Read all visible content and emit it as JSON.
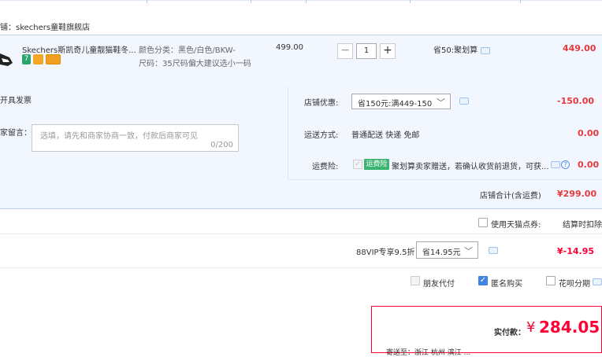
{
  "store": {
    "name": "铺：skechers童鞋旗舰店"
  },
  "item": {
    "title": "Skechers斯凯奇儿童靓猫鞋冬...",
    "sku_line1": "颜色分类：黑色/白色/BKW-",
    "sku_line2": "尺码：35尺码偏大建议选小一码",
    "unit_price": "499.00",
    "quantity": "1",
    "qty_minus": "−",
    "qty_plus": "+",
    "discount_label": "省50:聚划算",
    "subtotal": "449.00"
  },
  "invoice": {
    "label": "开具发票"
  },
  "message": {
    "label": "家留言：",
    "placeholder": "选填，请先和商家协商一致，付款后商家可见",
    "counter": "0/200"
  },
  "store_promo": {
    "label": "店铺优惠:",
    "selected": "省150元:满449-150",
    "amount": "-150.00"
  },
  "shipping": {
    "label": "运送方式:",
    "value": "普通配送 快递 免邮",
    "amount": "0.00"
  },
  "insurance": {
    "label": "运费险:",
    "tag": "运费险",
    "text": "聚划算卖家赠送，若确认收货前退货，可获...",
    "amount": "0.00"
  },
  "store_total": {
    "label": "店铺合计(含运费)",
    "amount": "¥299.00"
  },
  "tmall_points": {
    "label": "使用天猫点券:",
    "note": "结算时扣除"
  },
  "vip": {
    "label": "88VIP专享9.5折",
    "selected": "省14.95元",
    "amount": "¥-14.95"
  },
  "options": {
    "friend_pay": "朋友代付",
    "anonymous": "匿名购买",
    "huabei": "花呗分期"
  },
  "payment": {
    "label": "实付款：",
    "currency": "¥",
    "amount": "284.05",
    "footer": "寄送至：浙江 杭州 滨江 ..."
  },
  "colors": {
    "accent_red": "#ff0036",
    "panel_blue": "#f2f7ff",
    "check_blue": "#3f85e1",
    "insurance_green": "#3cb371"
  }
}
